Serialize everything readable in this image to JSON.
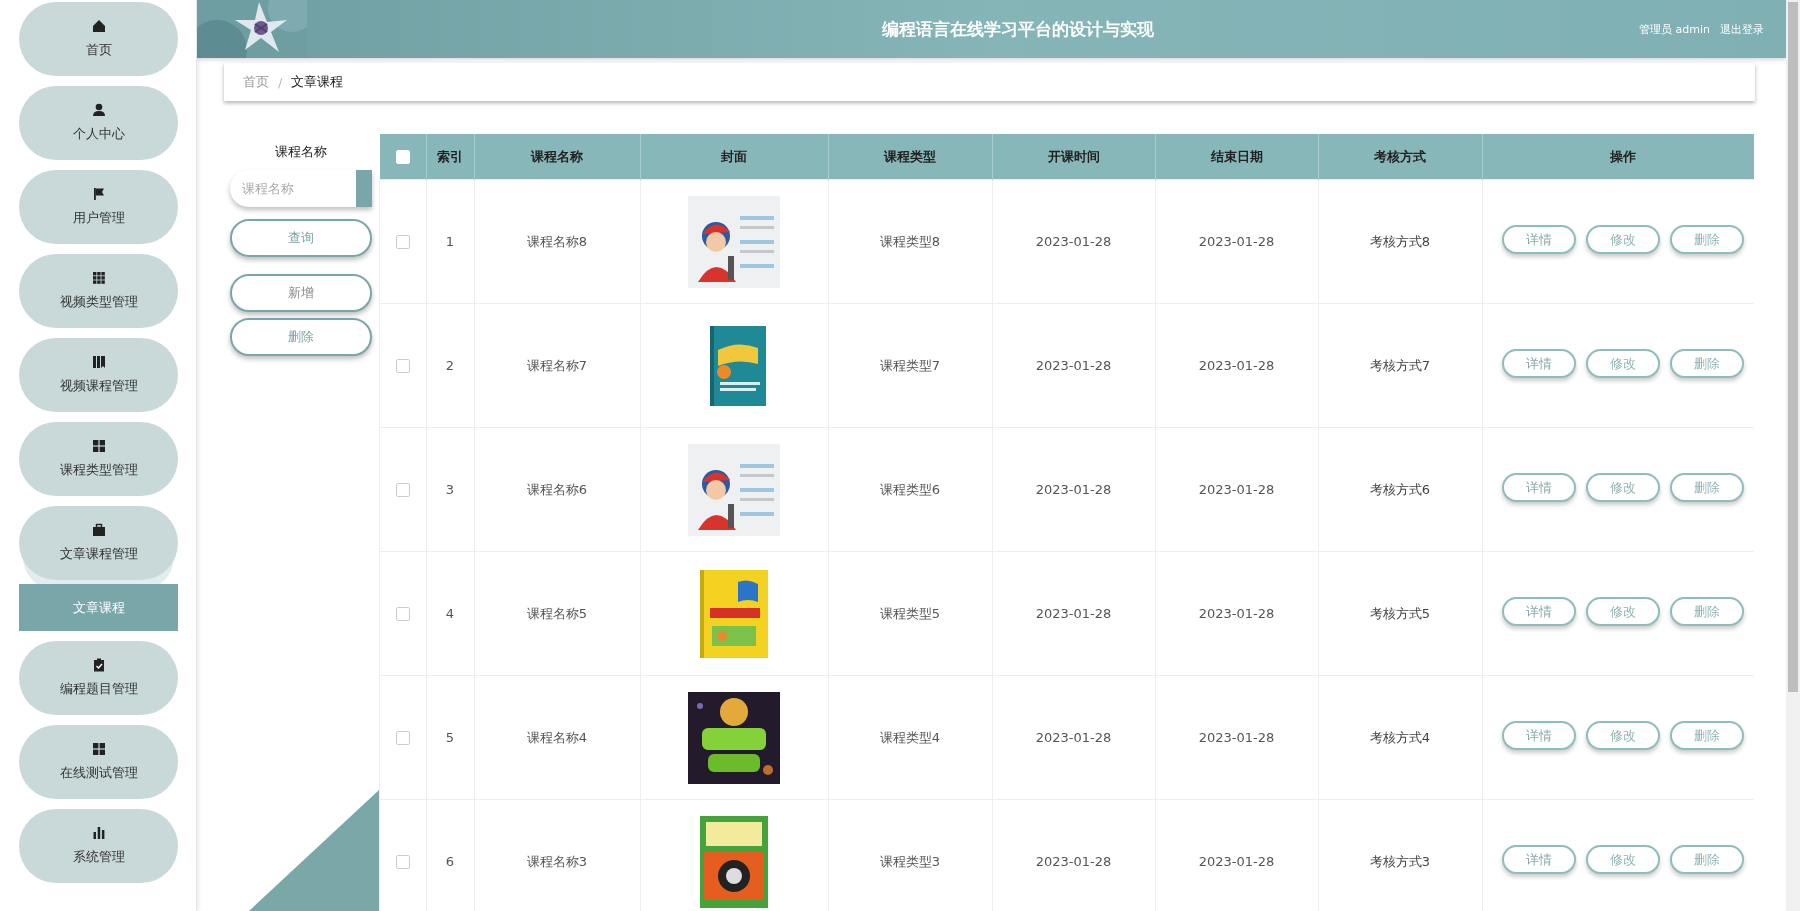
{
  "sidebar": {
    "items": [
      {
        "label": "首页",
        "expanded": false
      },
      {
        "label": "个人中心",
        "expanded": false
      },
      {
        "label": "用户管理",
        "expanded": false
      },
      {
        "label": "视频类型管理",
        "expanded": false
      },
      {
        "label": "视频课程管理",
        "expanded": false
      },
      {
        "label": "课程类型管理",
        "expanded": false
      },
      {
        "label": "文章课程管理",
        "expanded": true,
        "children": [
          {
            "label": "文章课程",
            "selected": true
          }
        ]
      },
      {
        "label": "编程题目管理",
        "expanded": false
      },
      {
        "label": "在线测试管理",
        "expanded": false
      },
      {
        "label": "系统管理",
        "expanded": false
      }
    ]
  },
  "header": {
    "title": "编程语言在线学习平台的设计与实现",
    "user": "管理员 admin",
    "logout": "退出登录"
  },
  "breadcrumb": {
    "separator": "/",
    "items": [
      "首页",
      "文章课程"
    ]
  },
  "search": {
    "label": "课程名称",
    "placeholder": "课程名称",
    "buttons": [
      "查询",
      "新增",
      "删除"
    ]
  },
  "table": {
    "select_all": {
      "checked": false
    },
    "columns": [
      "索引",
      "课程名称",
      "封面",
      "课程类型",
      "开课时间",
      "结束日期",
      "考核方式",
      "操作"
    ],
    "rows": [
      {
        "checked": false,
        "index": "1",
        "name": "课程名称8",
        "type": "课程类型8",
        "start": "2023-01-28",
        "end": "2023-01-28",
        "assessment": "考核方式8",
        "actions": [
          "详情",
          "修改",
          "删除"
        ]
      },
      {
        "checked": false,
        "index": "2",
        "name": "课程名称7",
        "type": "课程类型7",
        "start": "2023-01-28",
        "end": "2023-01-28",
        "assessment": "考核方式7",
        "actions": [
          "详情",
          "修改",
          "删除"
        ]
      },
      {
        "checked": false,
        "index": "3",
        "name": "课程名称6",
        "type": "课程类型6",
        "start": "2023-01-28",
        "end": "2023-01-28",
        "assessment": "考核方式6",
        "actions": [
          "详情",
          "修改",
          "删除"
        ]
      },
      {
        "checked": false,
        "index": "4",
        "name": "课程名称5",
        "type": "课程类型5",
        "start": "2023-01-28",
        "end": "2023-01-28",
        "assessment": "考核方式5",
        "actions": [
          "详情",
          "修改",
          "删除"
        ]
      },
      {
        "checked": false,
        "index": "5",
        "name": "课程名称4",
        "type": "课程类型4",
        "start": "2023-01-28",
        "end": "2023-01-28",
        "assessment": "考核方式4",
        "actions": [
          "详情",
          "修改",
          "删除"
        ]
      },
      {
        "checked": false,
        "index": "6",
        "name": "课程名称3",
        "type": "课程类型3",
        "start": "2023-01-28",
        "end": "2023-01-28",
        "assessment": "考核方式3",
        "actions": [
          "详情",
          "修改",
          "删除"
        ]
      }
    ]
  }
}
